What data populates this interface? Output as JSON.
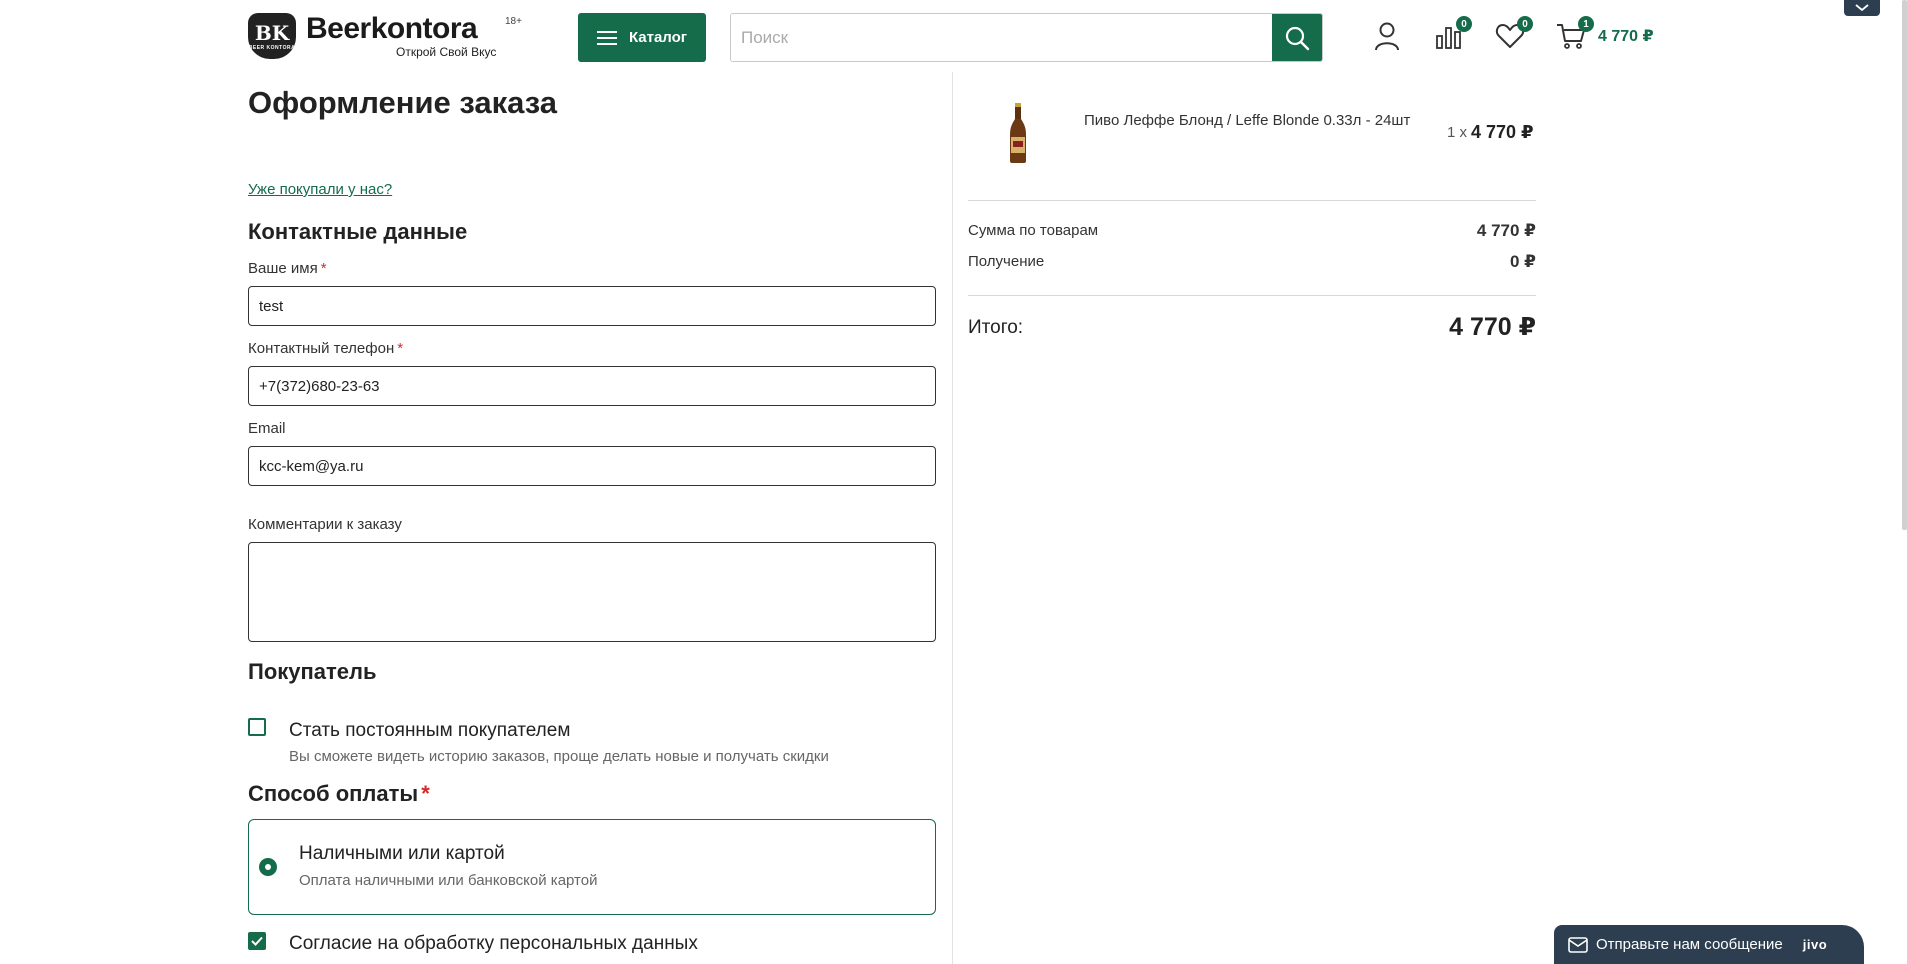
{
  "header": {
    "logo_name": "Beerkontora",
    "logo_badge": "BK",
    "logo_badge_small": "BEER KONTORA",
    "logo_age": "18+",
    "logo_slogan": "Открой Свой Вкус",
    "catalog_label": "Каталог",
    "search_placeholder": "Поиск",
    "compare_count": "0",
    "favorites_count": "0",
    "cart_count": "1",
    "cart_total": "4 770 ₽"
  },
  "page": {
    "title": "Оформление заказа",
    "already_link": "Уже покупали у нас?"
  },
  "contacts": {
    "section_title": "Контактные данные",
    "name_label": "Ваше имя",
    "name_value": "test",
    "phone_label": "Контактный телефон",
    "phone_value": "+7(372)680-23-63",
    "email_label": "Email",
    "email_value": "kcc-kem@ya.ru",
    "comment_label": "Комментарии к заказу",
    "required_mark": "*"
  },
  "buyer": {
    "section_title": "Покупатель",
    "regular_label": "Стать постоянным покупателем",
    "regular_sub": "Вы сможете видеть историю заказов, проще делать новые и получать скидки",
    "regular_checked": false
  },
  "payment": {
    "section_title": "Способ оплаты",
    "option_title": "Наличными или картой",
    "option_sub": "Оплата наличными или банковской картой",
    "selected": true
  },
  "consent": {
    "label": "Согласие на обработку персональных данных",
    "checked": true
  },
  "summary": {
    "product_name": "Пиво Леффе Блонд / Leffe Blonde 0.33л - 24шт",
    "product_qty": "1 x",
    "product_price": "4 770 ₽",
    "goods_label": "Сумма по товарам",
    "goods_value": "4 770 ₽",
    "delivery_label": "Получение",
    "delivery_value": "0 ₽",
    "total_label": "Итого:",
    "total_value": "4 770 ₽"
  },
  "chat": {
    "label": "Отправьте нам сообщение",
    "brand": "jivo"
  },
  "colors": {
    "accent": "#146c4b",
    "required": "#d42a2a",
    "chat_bg": "#2c3e50"
  },
  "icons": {
    "search": "search-icon",
    "user": "user-icon",
    "compare": "compare-icon",
    "favorites": "heart-icon",
    "cart": "cart-icon",
    "chat": "mail-icon"
  }
}
